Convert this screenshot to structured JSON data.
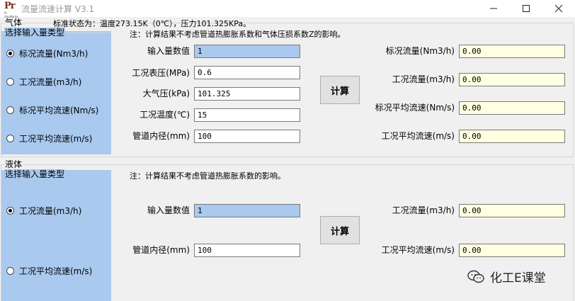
{
  "window": {
    "title": "流量流速计算 V3.1",
    "icon": {
      "main": "Pr",
      "sub": "Pr AppName"
    },
    "controls": [
      "minimize-icon",
      "maximize-icon",
      "close-icon"
    ]
  },
  "gas": {
    "group_label": "气体",
    "standard_state": "标准状态为：温度273.15K（0℃），压力101.325KPa。",
    "note": "注：计算结果不考虑管道热膨胀系数和气体压损系数Z的影响。",
    "type_group_label": "选择输入量类型",
    "radio_options": [
      {
        "label": "标况流量(Nm3/h)",
        "checked": true
      },
      {
        "label": "工况流量(m3/h)",
        "checked": false
      },
      {
        "label": "标况平均流速(Nm/s)",
        "checked": false
      },
      {
        "label": "工况平均流速(m/s)",
        "checked": false
      }
    ],
    "inputs": [
      {
        "label": "输入量数值",
        "value": "1"
      },
      {
        "label": "工况表压(MPa)",
        "value": "0.6"
      },
      {
        "label": "大气压(kPa)",
        "value": "101.325"
      },
      {
        "label": "工况温度(℃)",
        "value": "15"
      },
      {
        "label": "管道内径(mm)",
        "value": "100"
      }
    ],
    "calc_button": "计算",
    "outputs": [
      {
        "label": "标况流量(Nm3/h)",
        "value": "0.00"
      },
      {
        "label": "工况流量(m3/h)",
        "value": "0.00"
      },
      {
        "label": "标况平均流速(Nm/s)",
        "value": "0.00"
      },
      {
        "label": "工况平均流速(m/s)",
        "value": "0.00"
      }
    ]
  },
  "liquid": {
    "group_label": "液体",
    "note": "注：计算结果不考虑管道热膨胀系数的影响。",
    "type_group_label": "选择输入量类型",
    "radio_options": [
      {
        "label": "工况流量(m3/h)",
        "checked": true
      },
      {
        "label": "工况平均流速(m/s)",
        "checked": false
      }
    ],
    "inputs": [
      {
        "label": "输入量数值",
        "value": "1"
      },
      {
        "label": "管道内径(mm)",
        "value": "100"
      }
    ],
    "calc_button": "计算",
    "outputs": [
      {
        "label": "工况流量(m3/h)",
        "value": "0.00"
      },
      {
        "label": "工况平均流速(m/s)",
        "value": "0.00"
      }
    ]
  },
  "watermark": {
    "text": "化工E课堂",
    "icon": "wechat-icon"
  },
  "colors": {
    "panel_blue": "#a9c9ef",
    "output_yellow": "#ffffe1",
    "title_gray": "#999999"
  }
}
